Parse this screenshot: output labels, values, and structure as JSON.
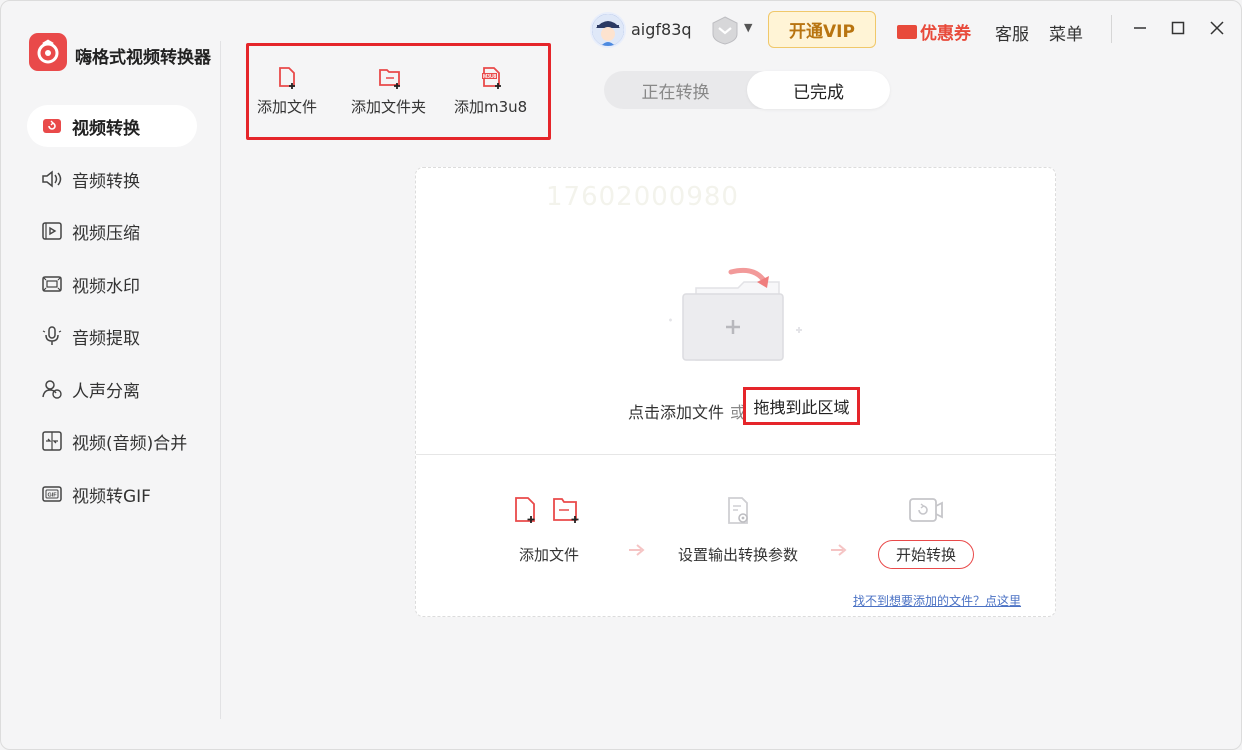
{
  "app": {
    "title": "嗨格式视频转换器",
    "accent_color": "#e94a4a",
    "highlight_color": "#e5252a"
  },
  "sidebar": {
    "items": [
      {
        "label": "视频转换",
        "icon": "video-convert-icon",
        "active": true
      },
      {
        "label": "音频转换",
        "icon": "speaker-icon"
      },
      {
        "label": "视频压缩",
        "icon": "video-compress-icon"
      },
      {
        "label": "视频水印",
        "icon": "watermark-icon"
      },
      {
        "label": "音频提取",
        "icon": "microphone-icon"
      },
      {
        "label": "人声分离",
        "icon": "voice-separate-icon"
      },
      {
        "label": "视频(音频)合并",
        "icon": "merge-icon"
      },
      {
        "label": "视频转GIF",
        "icon": "gif-icon"
      }
    ]
  },
  "header": {
    "username": "aigf83q",
    "vip_label": "开通VIP",
    "coupon_label": "优惠券",
    "service_label": "客服",
    "menu_label": "菜单"
  },
  "toolbar": {
    "add_file": "添加文件",
    "add_folder": "添加文件夹",
    "add_m3u8": "添加m3u8",
    "m3u8_badge": "M3U8"
  },
  "tabs": [
    {
      "label": "正在转换",
      "active": false
    },
    {
      "label": "已完成",
      "active": true
    }
  ],
  "dropzone": {
    "watermark": "17602000980",
    "click_text": "点击添加文件",
    "or_text": "或",
    "drag_text": "拖拽到此区域",
    "steps": {
      "add_file": "添加文件",
      "set_params": "设置输出转换参数",
      "start": "开始转换"
    },
    "help_link": "找不到想要添加的文件？点这里"
  }
}
